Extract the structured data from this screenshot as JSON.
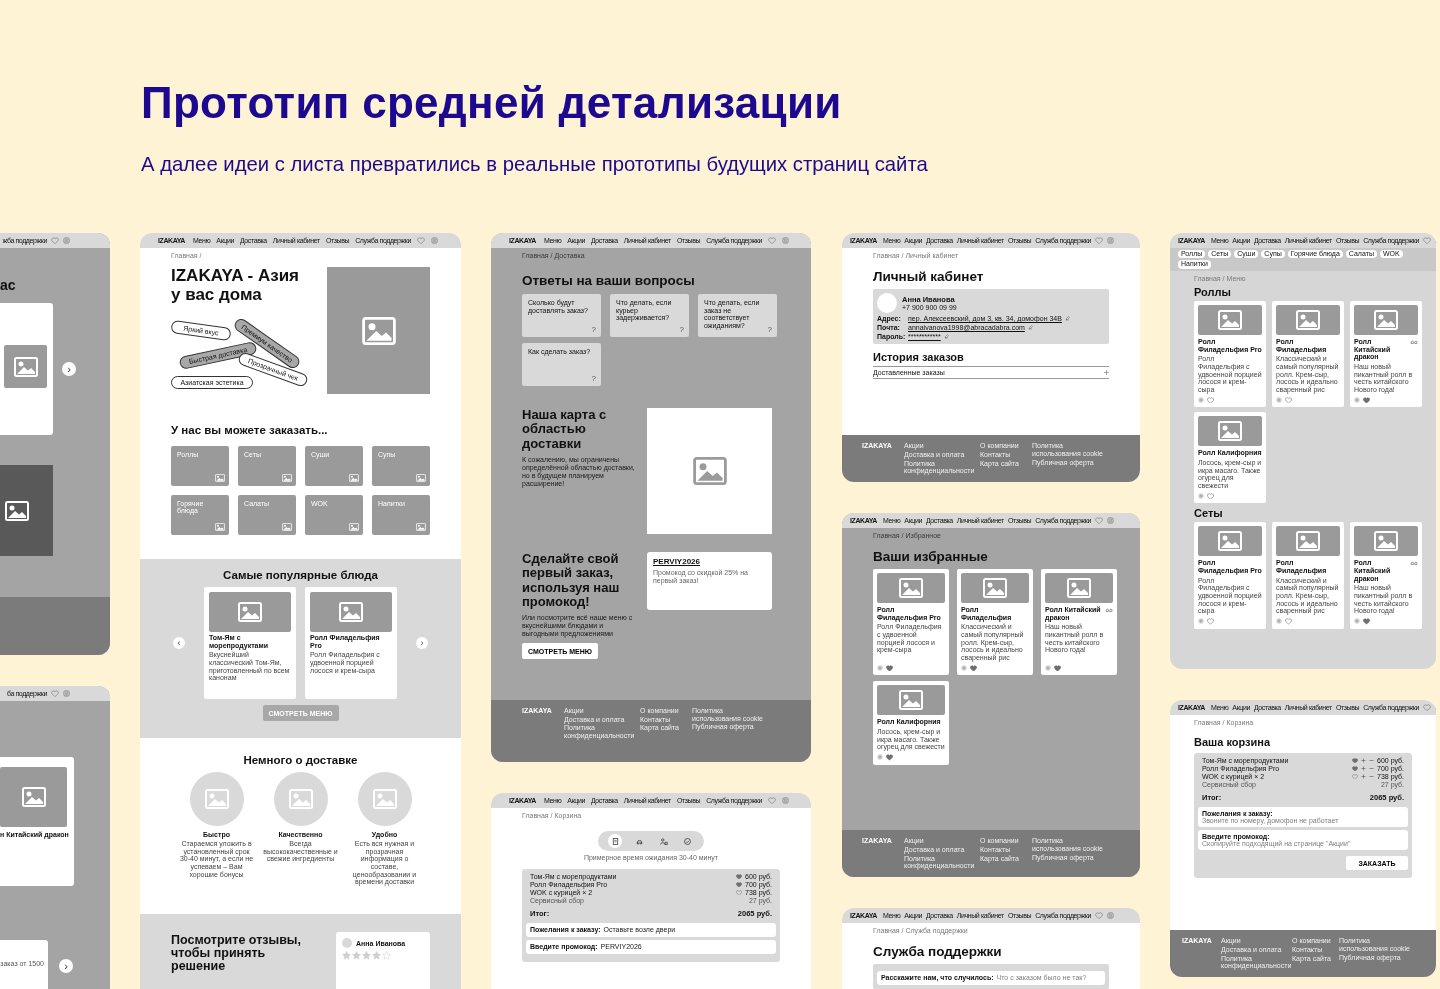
{
  "heading": "Прототип средней детализации",
  "subheading": "А далее идеи с листа превратились в реальные прототипы будущих страниц сайта",
  "boards": [
    {
      "kind": "fragment",
      "nav": {
        "items": [
          "жба поддержки"
        ]
      },
      "title": "ас",
      "arrow": "›"
    },
    {
      "kind": "fragment",
      "nav": {
        "items": [
          "ба поддержки"
        ]
      },
      "card_title": "н Китайский дракон",
      "note": "заказ от 1500",
      "arrow": "›"
    },
    {
      "kind": "home",
      "nav": {
        "logo": "IZAKAYA",
        "items": [
          "Меню",
          "Акции",
          "Доставка",
          "Личный кабинет",
          "Отзывы",
          "Служба поддержки"
        ]
      },
      "breadcrumb": "Главная /",
      "title": "IZAKAYA - Азия у вас дома",
      "tags": [
        {
          "label": "Яркий вкус",
          "filled": false
        },
        {
          "label": "Премиум качество",
          "filled": true
        },
        {
          "label": "Быстрая доставка",
          "filled": true
        },
        {
          "label": "Прозрачный чек",
          "filled": false
        },
        {
          "label": "Азиатская эстетика",
          "filled": false
        }
      ],
      "categories_title": "У нас вы можете заказать...",
      "categories": [
        "Роллы",
        "Сеты",
        "Суши",
        "Супы",
        "Горячие блюда",
        "Салаты",
        "WOK",
        "Напитки"
      ],
      "popular_title": "Самые популярные блюда",
      "popular": [
        {
          "title": "Том-Ям с морепродуктами",
          "text": "Вкуснейший классический Том-Ям, приготовленный по всем канонам"
        },
        {
          "title": "Ролл Филадельфия Pro",
          "text": "Ролл Филадельфия с удвоенной порцией лосося и крем-сыра"
        }
      ],
      "prev": "‹",
      "next": "›",
      "menu_button": "СМОТРЕТЬ МЕНЮ",
      "delivery_title": "Немного о доставке",
      "features": [
        {
          "title": "Быстро",
          "text": "Стараемся уложить в установленный срок 30-40 минут, а если не успеваем – Вам хорошие бонусы"
        },
        {
          "title": "Качественно",
          "text": "Всегда высококачественные и свежие ингредиенты"
        },
        {
          "title": "Удобно",
          "text": "Есть вся нужная и прозрачная информация о составе, ценообразовании и времени доставки"
        }
      ],
      "reviews_title": "Посмотрите отзывы, чтобы принять решение",
      "review": {
        "name": "Анна Иванова",
        "stars": 4
      }
    },
    {
      "kind": "faq",
      "nav": {
        "logo": "IZAKAYA",
        "items": [
          "Меню",
          "Акции",
          "Доставка",
          "Личный кабинет",
          "Отзывы",
          "Служба поддержки"
        ]
      },
      "breadcrumb": "Главная / Доставка",
      "title": "Ответы на ваши вопросы",
      "faqs": [
        {
          "question": "Сколько будут доставлять заказ?",
          "mark": "?"
        },
        {
          "question": "Что делать, если курьер задерживается?",
          "mark": "?"
        },
        {
          "question": "Что делать, если заказ не соответствует ожиданиям?",
          "mark": "?"
        },
        {
          "question": "Как сделать заказ?",
          "mark": "?"
        }
      ],
      "map_title": "Наша карта с областью доставки",
      "map_text": "К сожалению, мы ограничены определённой областью доставки, но в будущем планируем расширение!",
      "promo_title": "Сделайте свой первый заказ, используя наш промокод!",
      "promo_text": "Или посмотрите всё наше меню с вкуснейшими блюдами и выгодными предложениями",
      "menu_button": "СМОТРЕТЬ МЕНЮ",
      "promo_code": "PERVIY2026",
      "promo_note": "Промокод со скидкой 25% на первый заказ!",
      "footer": {
        "logo": "IZAKAYA",
        "links": [
          "Акции",
          "Доставка и оплата",
          "Политика конфиденциальности",
          "О компании",
          "Контакты",
          "Карта сайта",
          "Политика использования cookie",
          "Публичная оферта"
        ]
      }
    },
    {
      "kind": "order",
      "nav": {
        "logo": "IZAKAYA",
        "items": [
          "Меню",
          "Акции",
          "Доставка",
          "Личный кабинет",
          "Отзывы",
          "Служба поддержки"
        ]
      },
      "breadcrumb": "Главная / Корзина",
      "steps": [
        {
          "selected": true
        },
        {
          "selected": false
        },
        {
          "selected": false
        },
        {
          "selected": false
        }
      ],
      "wait_note": "Примерное время ожидания 30-40 минут",
      "items": [
        {
          "name": "Том-Ям с морепродуктами",
          "price": "600 руб.",
          "favorite": true
        },
        {
          "name": "Ролл Филадельфия Pro",
          "price": "700 руб.",
          "favorite": true
        },
        {
          "name": "WOK с курицей × 2",
          "price": "738 руб.",
          "favorite": false
        }
      ],
      "fee": {
        "name": "Сервисный сбор",
        "price": "27 руб."
      },
      "total_label": "Итог:",
      "total": "2065 руб.",
      "wishes": {
        "label": "Пожелания к заказу:",
        "value": "Оставьте возле двери"
      },
      "promo": {
        "label": "Введите промокод:",
        "value": "PERVIY2026"
      }
    },
    {
      "kind": "cabinet",
      "nav": {
        "logo": "IZAKAYA",
        "items": [
          "Меню",
          "Акции",
          "Доставка",
          "Личный кабинет",
          "Отзывы",
          "Служба поддержки"
        ]
      },
      "breadcrumb": "Главная / Личный кабинет",
      "title": "Личный кабинет",
      "profile": {
        "name": "Анна Иванова",
        "phone": "+7 900 900 09 99",
        "fields": [
          {
            "label": "Адрес:",
            "value": "пер. Алексеевский, дом 3, кв. 34, домофон 34В"
          },
          {
            "label": "Почта:",
            "value": "annaivanova1998@abracadabra.com"
          },
          {
            "label": "Пароль:",
            "value": "************"
          }
        ]
      },
      "history_title": "История заказов",
      "history_row": "Доставленные заказы",
      "footer": {
        "logo": "IZAKAYA",
        "links": [
          "Акции",
          "Доставка и оплата",
          "Политика конфиденциальности",
          "О компании",
          "Контакты",
          "Карта сайта",
          "Политика использования cookie",
          "Публичная оферта"
        ]
      }
    },
    {
      "kind": "favorites",
      "nav": {
        "logo": "IZAKAYA",
        "items": [
          "Меню",
          "Акции",
          "Доставка",
          "Личный кабинет",
          "Отзывы",
          "Служба поддержки"
        ]
      },
      "breadcrumb": "Главная / Избранное",
      "title": "Ваши избранные",
      "products": [
        {
          "title": "Ролл Филадельфия Pro",
          "text": "Ролл Филадельфия с удвоенной порцией лосося и крем-сыра",
          "spicy": false,
          "favorite": true
        },
        {
          "title": "Ролл Филадельфия",
          "text": "Классический и самый популярный ролл. Крем-сыр, лосось и идеально сваренный рис",
          "spicy": false,
          "favorite": true
        },
        {
          "title": "Ролл Китайский дракон",
          "text": "Наш новый пикантный ролл в честь китайского Нового года!",
          "spicy": true,
          "favorite": true
        },
        {
          "title": "Ролл Калифорния",
          "text": "Лосось, крем-сыр и икра масаго. Также огурец для свежести",
          "spicy": false,
          "favorite": true
        }
      ],
      "footer": {
        "logo": "IZAKAYA",
        "links": [
          "Акции",
          "Доставка и оплата",
          "Политика конфиденциальности",
          "О компании",
          "Контакты",
          "Карта сайта",
          "Политика использования cookie",
          "Публичная оферта"
        ]
      }
    },
    {
      "kind": "support",
      "nav": {
        "logo": "IZAKAYA",
        "items": [
          "Меню",
          "Акции",
          "Доставка",
          "Личный кабинет",
          "Отзывы",
          "Служба поддержки"
        ]
      },
      "breadcrumb": "Главная / Служба поддержки",
      "title": "Служба поддержки",
      "field": {
        "label": "Расскажите нам, что случилось:",
        "placeholder": "Что с заказом было не так?"
      }
    },
    {
      "kind": "menu",
      "nav": {
        "logo": "IZAKAYA",
        "items": [
          "Меню",
          "Акции",
          "Доставка",
          "Личный кабинет",
          "Отзывы",
          "Служба поддержки"
        ]
      },
      "chips": [
        "Роллы",
        "Сеты",
        "Суши",
        "Супы",
        "Горячие блюда",
        "Салаты",
        "WOK",
        "Напитки"
      ],
      "breadcrumb": "Главная / Меню",
      "sections": [
        {
          "title": "Роллы",
          "products": [
            {
              "title": "Ролл Филадельфия Pro",
              "text": "Ролл Филадельфия с удвоенной порцией лосося и крем-сыра",
              "spicy": false,
              "favorite": false
            },
            {
              "title": "Ролл Филадельфия",
              "text": "Классический и самый популярный ролл. Крем-сыр, лосось и идеально сваренный рис",
              "spicy": false,
              "favorite": false
            },
            {
              "title": "Ролл Китайский дракон",
              "text": "Наш новый пикантный ролл в честь китайского Нового года!",
              "spicy": true,
              "favorite": true
            },
            {
              "title": "Ролл Калифорния",
              "text": "Лосось, крем-сыр и икра масаго. Также огурец для свежести",
              "spicy": false,
              "favorite": false
            }
          ]
        },
        {
          "title": "Сеты",
          "products": [
            {
              "title": "Ролл Филадельфия Pro",
              "text": "Ролл Филадельфия с удвоенной порцией лосося и крем-сыра",
              "spicy": false,
              "favorite": false
            },
            {
              "title": "Ролл Филадельфия",
              "text": "Классический и самый популярный ролл. Крем-сыр, лосось и идеально сваренный рис",
              "spicy": false,
              "favorite": false
            },
            {
              "title": "Ролл Китайский дракон",
              "text": "Наш новый пикантный ролл в честь китайского Нового года!",
              "spicy": true,
              "favorite": true
            }
          ]
        }
      ]
    },
    {
      "kind": "cart",
      "nav": {
        "logo": "IZAKAYA",
        "items": [
          "Меню",
          "Акции",
          "Доставка",
          "Личный кабинет",
          "Отзывы",
          "Служба поддержки"
        ]
      },
      "breadcrumb": "Главная / Корзина",
      "title": "Ваша корзина",
      "items": [
        {
          "name": "Том-Ям с морепродуктами",
          "price": "600 руб.",
          "favorite": true
        },
        {
          "name": "Ролл Филадельфия Pro",
          "price": "700 руб.",
          "favorite": true
        },
        {
          "name": "WOK с курицей × 2",
          "price": "738 руб.",
          "favorite": false
        }
      ],
      "fee": {
        "name": "Сервисный сбор",
        "price": "27 руб."
      },
      "total_label": "Итог:",
      "total": "2065 руб.",
      "wishes": {
        "label": "Пожелания к заказу:",
        "placeholder": "Звоните по номеру, домофон не работает"
      },
      "promo": {
        "label": "Введите промокод:",
        "placeholder": "Скопируйте подходящий на странице \"Акции\""
      },
      "order_button": "ЗАКАЗАТЬ",
      "footer": {
        "logo": "IZAKAYA",
        "links": [
          "Акции",
          "Доставка и оплата",
          "Политика конфиденциальности",
          "О компании",
          "Контакты",
          "Карта сайта",
          "Политика использования cookie",
          "Публичная оферта"
        ]
      }
    }
  ]
}
